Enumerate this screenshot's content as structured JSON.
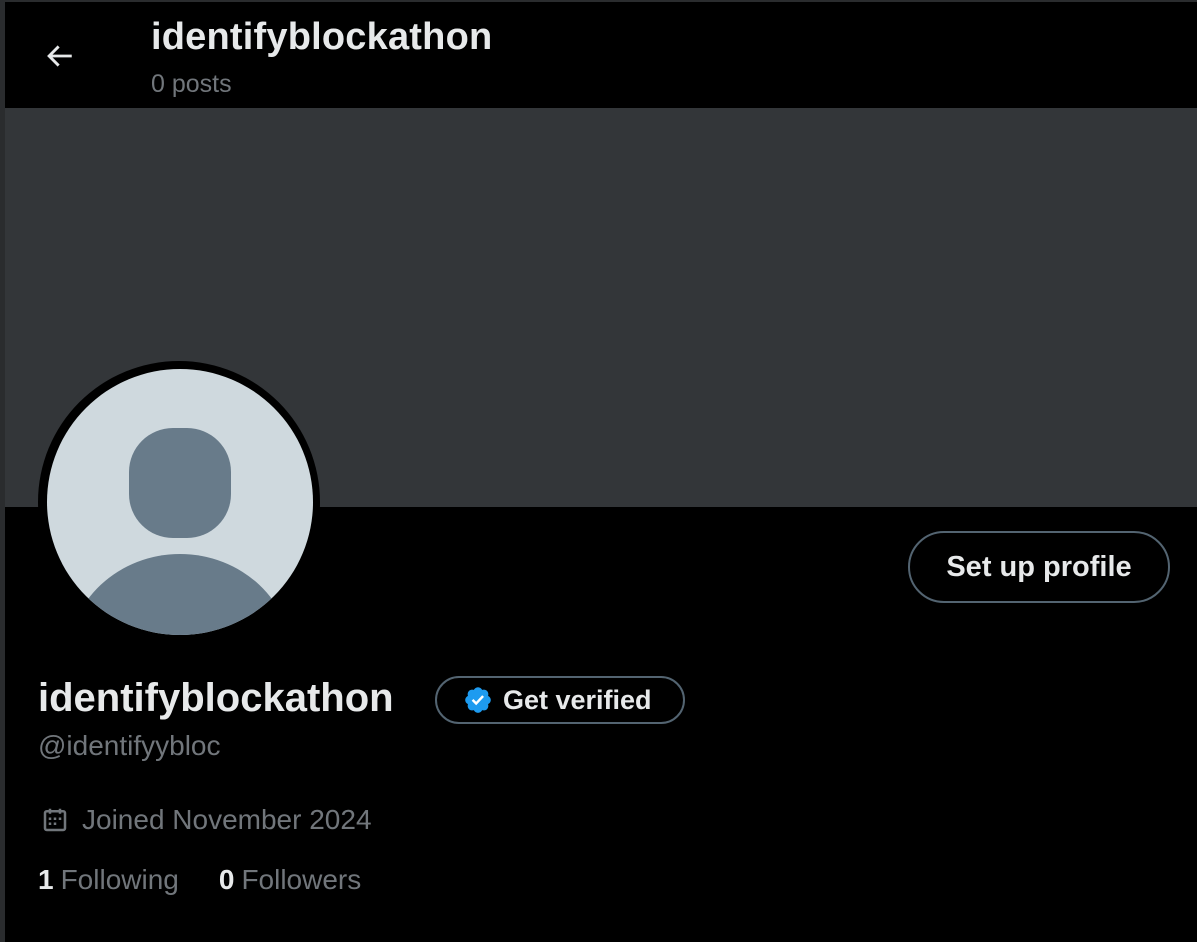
{
  "header": {
    "title": "identifyblockathon",
    "subtitle": "0 posts",
    "back_icon": "arrow-left-icon"
  },
  "profile": {
    "display_name": "identifyblockathon",
    "handle": "@identifyybloc",
    "joined": "Joined November 2024",
    "avatar_icon": "default-avatar-icon",
    "calendar_icon": "calendar-icon",
    "setup_label": "Set up profile",
    "verify_label": "Get verified",
    "verify_icon": "verified-badge-icon"
  },
  "stats": {
    "following_count": "1",
    "following_label": "Following",
    "followers_count": "0",
    "followers_label": "Followers"
  },
  "colors": {
    "background": "#000000",
    "banner": "#333639",
    "primary_text": "#e7e9ea",
    "secondary_text": "#71767b",
    "border": "#536471",
    "verified_blue": "#1d9bf0",
    "avatar_bg": "#cfd9de",
    "avatar_figure": "#687b8a"
  }
}
